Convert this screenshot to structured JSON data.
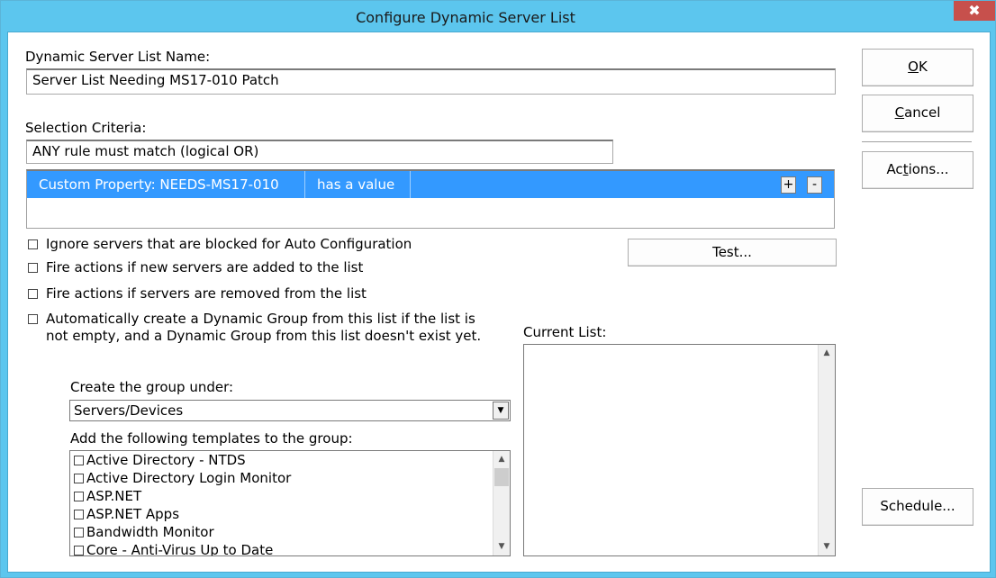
{
  "window": {
    "title": "Configure Dynamic Server List",
    "close_symbol": "✖",
    "accent_color": "#5cc6ee",
    "selection_color": "#3399ff"
  },
  "name_section": {
    "label": "Dynamic Server List Name:",
    "value": "Server List Needing MS17-010 Patch"
  },
  "criteria_section": {
    "label": "Selection Criteria:",
    "mode_value": "ANY rule must match (logical OR)",
    "rules": [
      {
        "property": "Custom Property: NEEDS-MS17-010",
        "condition": "has a value"
      }
    ],
    "add_label": "+",
    "remove_label": "-"
  },
  "options": [
    {
      "label": "Ignore servers that are blocked for Auto Configuration",
      "checked": false
    },
    {
      "label": "Fire actions if new servers are added to the list",
      "checked": false
    },
    {
      "label": "Fire actions if servers are removed from the list",
      "checked": false
    },
    {
      "label_line1": "Automatically create a Dynamic Group from this list if the list is",
      "label_line2": "not empty, and a Dynamic Group from this list doesn't exist yet.",
      "checked": false
    }
  ],
  "test_button": "Test...",
  "group": {
    "create_under_label": "Create the group under:",
    "create_under_value": "Servers/Devices",
    "templates_label": "Add the following templates to the group:",
    "templates": [
      "Active Directory - NTDS",
      "Active Directory Login Monitor",
      "ASP.NET",
      "ASP.NET Apps",
      "Bandwidth Monitor",
      "Core - Anti-Virus Up to Date"
    ]
  },
  "current_list": {
    "label": "Current List:"
  },
  "buttons": {
    "ok": {
      "hotkey": "O",
      "rest": "K"
    },
    "cancel": {
      "hotkey": "C",
      "rest": "ancel"
    },
    "actions": {
      "pre": "Ac",
      "hotkey": "t",
      "rest": "ions..."
    },
    "schedule": "Schedule..."
  },
  "icons": {
    "scroll_up": "▲",
    "scroll_down": "▼",
    "dropdown": "▼"
  }
}
